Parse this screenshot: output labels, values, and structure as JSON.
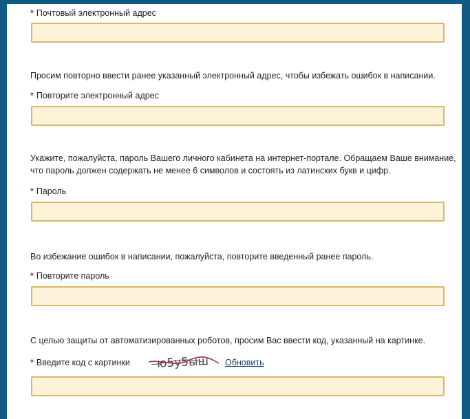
{
  "form": {
    "email_label": "Почтовый электронный адрес",
    "email_repeat_hint": "Просим повторно ввести ранее указанный электронный адрес, чтобы избежать ошибок в написании.",
    "email_repeat_label": "Повторите электронный адрес",
    "password_hint": "Укажите, пожалуйста, пароль Вашего личного кабинета на интернет-портале. Обращаем Ваше внимание, что пароль должен содержать не менее 6 символов и состоять из латинских букв и цифр.",
    "password_label": "Пароль",
    "password_repeat_hint": "Во избежание ошибок в написании, пожалуйста, повторите введенный ранее пароль.",
    "password_repeat_label": "Повторите пароль",
    "captcha_hint": "С целью защиты от автоматизированных роботов, просим Вас ввести код, указанный на картинке.",
    "captcha_label": "Введите код с картинки",
    "captcha_text": "ю5у5ыш",
    "refresh_label": "Обновить",
    "required_mark": "*"
  },
  "colors": {
    "field_bg": "#fdf3d8",
    "field_border": "#dcb56a",
    "required": "#c0392b",
    "page_border": "#0f5a85"
  }
}
